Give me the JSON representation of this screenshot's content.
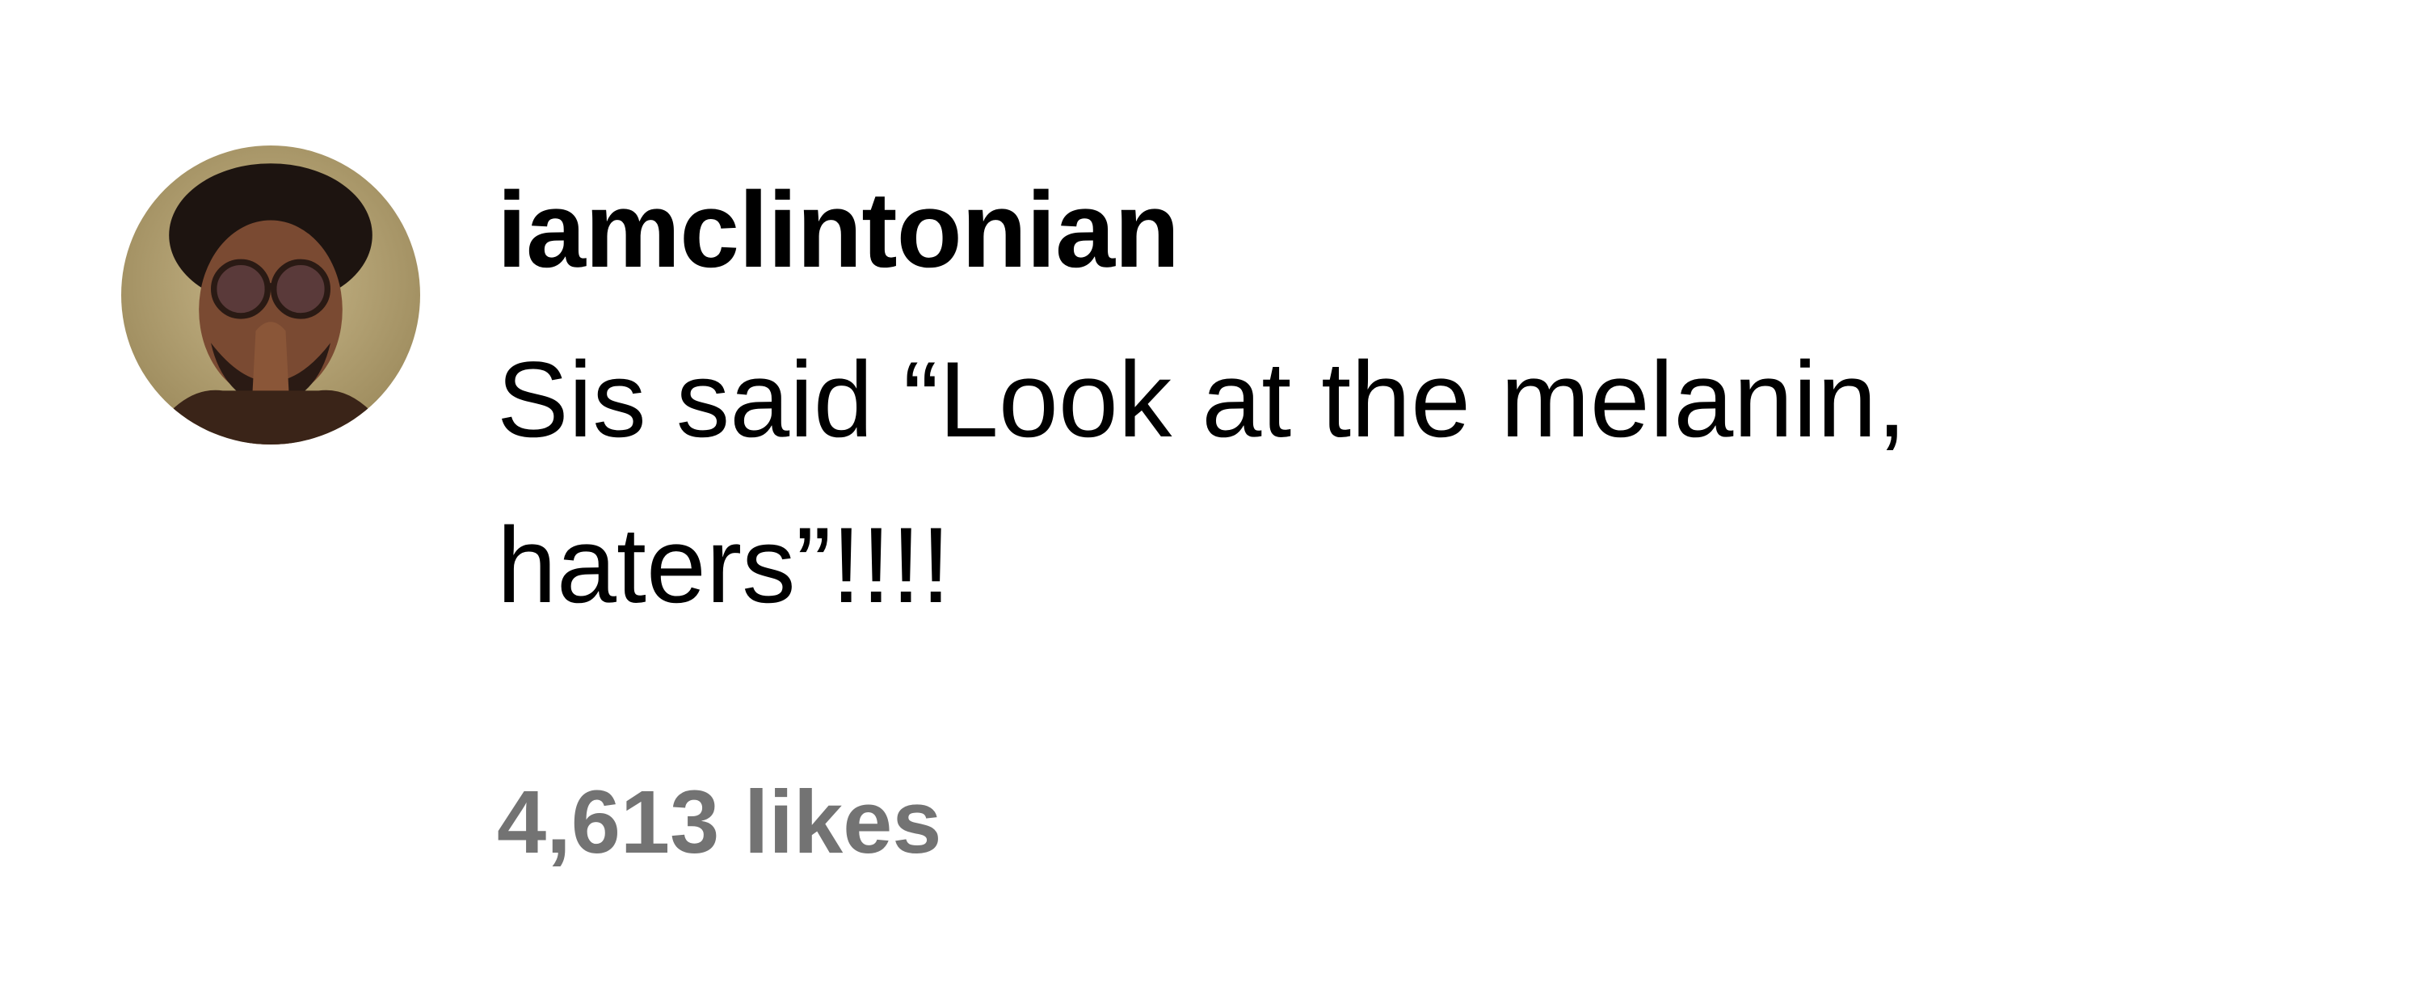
{
  "comment": {
    "username": "iamclintonian",
    "text_lines": [
      "Sis said “Look at the melanin,",
      "haters”!!!!"
    ],
    "likes": "4,613 likes",
    "avatar_icon": "profile-photo-icon"
  },
  "colors": {
    "text": "#000000",
    "secondary_text": "#737373",
    "background": "#ffffff"
  }
}
